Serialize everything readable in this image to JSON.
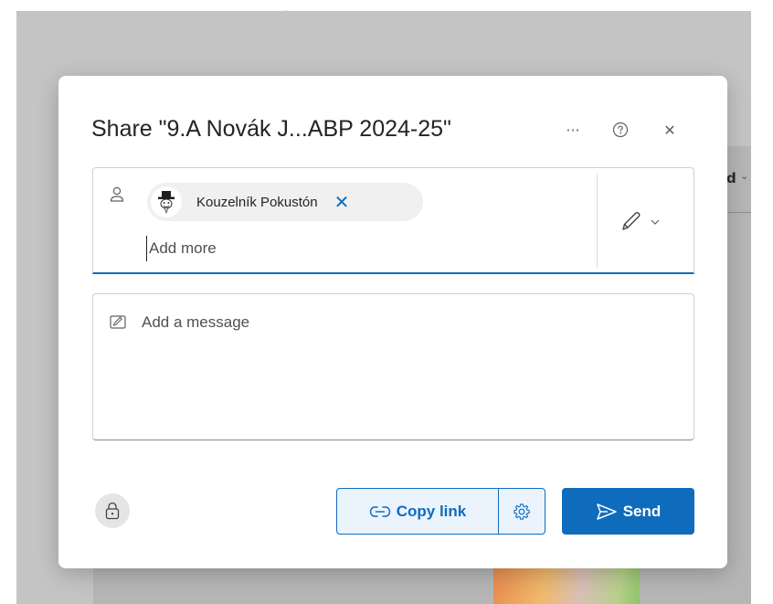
{
  "background": {
    "side_label": "d",
    "top_fragment": "_"
  },
  "dialog": {
    "title": "Share \"9.A Novák J...ABP 2024-25\"",
    "more_label": "···",
    "help_icon": "help-circle-icon",
    "close_label": "✕"
  },
  "recipients": {
    "people_icon": "person-icon",
    "chips": [
      {
        "name": "Kouzelník Pokustón",
        "remove_label": "✕"
      }
    ],
    "add_more_placeholder": "Add more",
    "permission_icon": "pencil-icon"
  },
  "message": {
    "placeholder": "Add a message",
    "icon": "edit-note-icon"
  },
  "footer": {
    "lock_icon": "lock-icon",
    "copy_link_label": "Copy link",
    "settings_icon": "gear-icon",
    "send_label": "Send"
  },
  "colors": {
    "accent": "#0f6cbd",
    "accent_light": "#ebf3fc",
    "text": "#242424"
  }
}
